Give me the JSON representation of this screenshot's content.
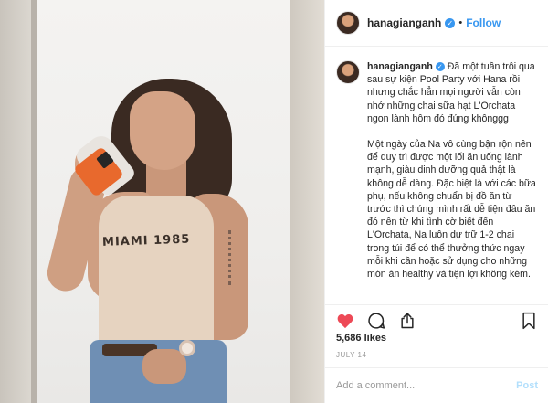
{
  "post": {
    "username": "hanagianganh",
    "follow_label": "Follow",
    "separator": "•",
    "verified_glyph": "✓",
    "caption": {
      "paragraph1": "Đã một tuần trôi qua sau sự kiện Pool Party với Hana rồi nhưng chắc hẳn mọi người vẫn còn nhớ những chai sữa hạt L'Orchata ngon lành hôm đó đúng khônggg",
      "paragraph2": "Một ngày của Na vô cùng bận rộn nên để duy trì được một lối ăn uống lành mạnh, giàu dinh dưỡng quả thật là không dễ dàng. Đặc biệt là với các bữa phụ, nếu không chuẩn bị đồ ăn từ trước thì chúng mình rất dễ tiện đâu ăn đó nên từ khi tình cờ biết đến L'Orchata, Na luôn dự trữ 1-2 chai trong túi để có thể thưởng thức ngay mỗi khi cần hoặc sử dụng cho những món ăn healthy và tiện lợi không kém."
    },
    "photo_shirt_text": "MIAMI 1985",
    "likes": "5,686 likes",
    "date": "JULY 14",
    "comment_placeholder": "Add a comment...",
    "post_label": "Post"
  },
  "icons": {
    "like": "heart-icon",
    "comment": "comment-icon",
    "share": "share-icon",
    "save": "bookmark-icon",
    "verified": "verified-badge-icon"
  },
  "colors": {
    "like_red": "#ed4956",
    "follow_blue": "#3897f0",
    "post_disabled": "#b2dffc",
    "muted": "#999999"
  }
}
